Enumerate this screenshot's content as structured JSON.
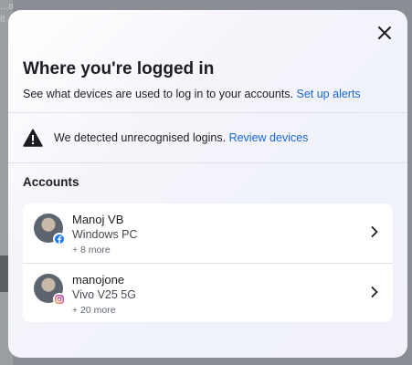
{
  "background": {
    "partial_lines": [
      "...and",
      "it"
    ]
  },
  "dialog": {
    "title": "Where you're logged in",
    "subtitle": "See what devices are used to log in to your accounts.",
    "setup_alerts_link": "Set up alerts",
    "warning": {
      "icon": "warning-triangle-icon",
      "text": "We detected unrecognised logins.",
      "review_link": "Review devices"
    },
    "accounts_label": "Accounts",
    "accounts": [
      {
        "name": "Manoj VB",
        "device": "Windows PC",
        "more": "+ 8 more",
        "platform_icon": "facebook-icon"
      },
      {
        "name": "manojone",
        "device": "Vivo V25 5G",
        "more": "+ 20 more",
        "platform_icon": "instagram-icon"
      }
    ],
    "colors": {
      "link": "#1a66d6",
      "facebook": "#1877f2",
      "text": "#1c1e21"
    }
  }
}
